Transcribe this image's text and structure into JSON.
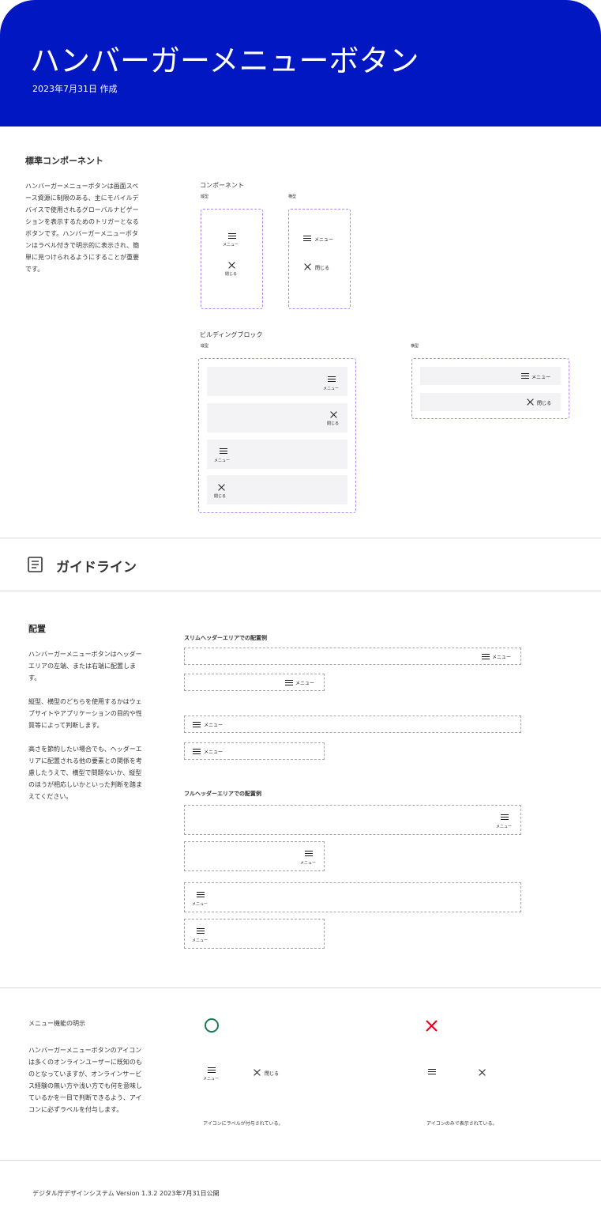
{
  "header": {
    "title": "ハンバーガーメニューボタン",
    "date": "2023年7月31日 作成"
  },
  "standard": {
    "heading": "標準コンポーネント",
    "description": "ハンバーガーメニューボタンは画面スペース資源に制限のある、主にモバイルデバイスで使用されるグローバルナビゲーションを表示するためのトリガーとなるボタンです。ハンバーガーメニューボタンはラベル付きで明示的に表示され、簡単に見つけられるようにすることが重要です。",
    "component_label": "コンポーネント",
    "building_block_label": "ビルディングブロック",
    "vertical": "縦型",
    "horizontal": "横型",
    "menu": "メニュー",
    "close": "閉じる"
  },
  "guideline": {
    "title": "ガイドライン"
  },
  "placement": {
    "heading": "配置",
    "p1": "ハンバーガーメニューボタンはヘッダーエリアの左端、または右端に配置します。",
    "p2": "縦型、横型のどちらを使用するかはウェブサイトやアプリケーションの目的や性質等によって判断します。",
    "p3": "高さを節約したい場合でも、ヘッダーエリアに配置される他の要素との関係を考慮したうえで、横型で問題ないか、縦型のほうが相応しいかといった判断を踏まえてください。",
    "slim_title": "スリムヘッダーエリアでの配置例",
    "full_title": "フルヘッダーエリアでの配置例"
  },
  "explicit": {
    "heading": "メニュー機能の明示",
    "description": "ハンバーガーメニューボタンのアイコンは多くのオンラインユーザーに既知のものとなっていますが、オンラインサービス経験の無い方や浅い方でも何を意味しているかを一目で判断できるよう、アイコンに必ずラベルを付与します。",
    "good_caption": "アイコンにラベルが付与されている。",
    "bad_caption": "アイコンのみで表示されている。"
  },
  "footer": {
    "text": "デジタル庁デザインシステム Version 1.3.2  2023年7月31日公開"
  },
  "colors": {
    "brand_blue": "#0017c1",
    "good_green": "#1e7a4f",
    "bad_red": "#e3001b",
    "dash_purple": "#b186f2"
  }
}
